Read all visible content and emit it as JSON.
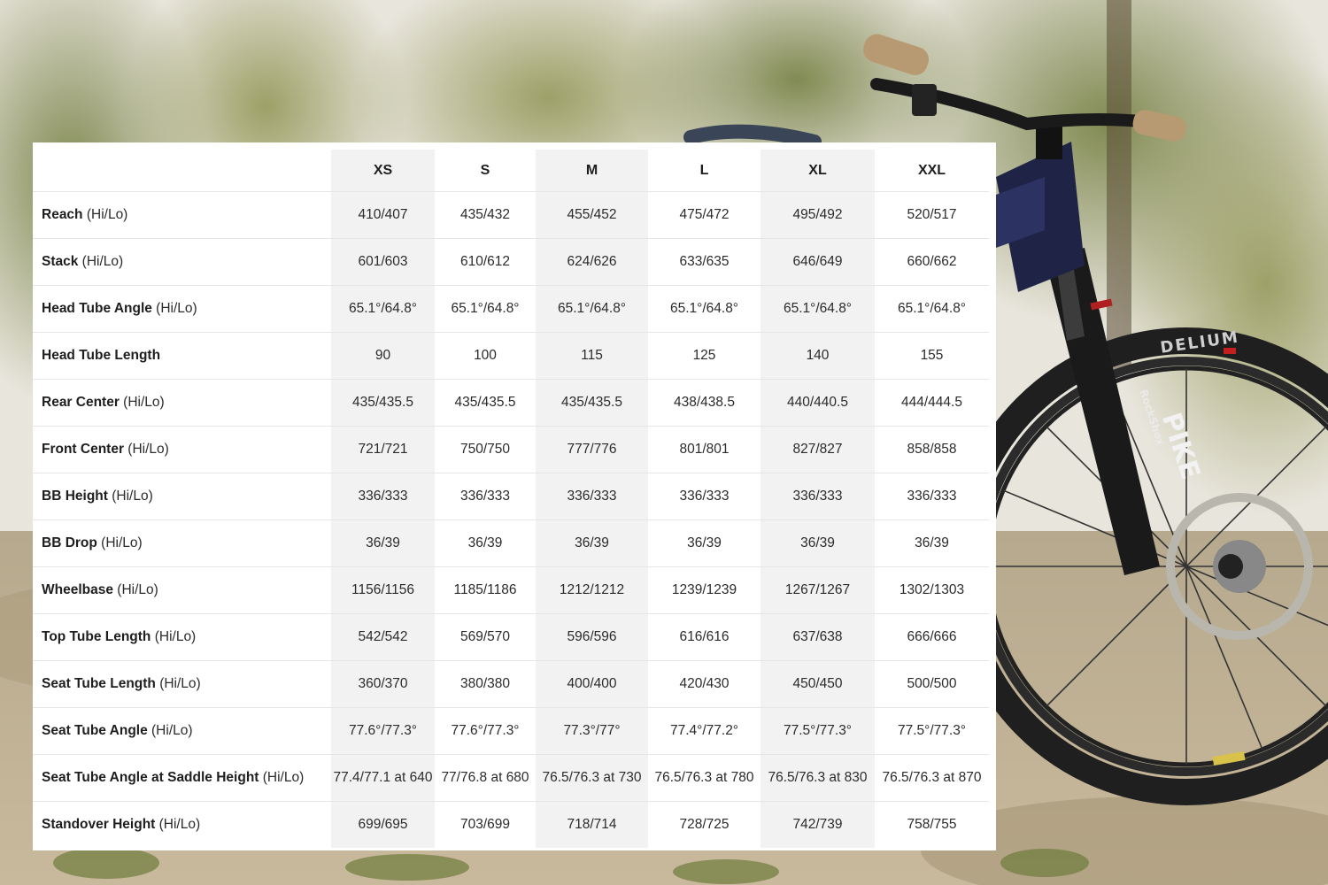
{
  "sizes": [
    "XS",
    "S",
    "M",
    "L",
    "XL",
    "XXL"
  ],
  "rows": [
    {
      "name": "Reach",
      "suffix": " (Hi/Lo)",
      "values": [
        "410/407",
        "435/432",
        "455/452",
        "475/472",
        "495/492",
        "520/517"
      ]
    },
    {
      "name": "Stack",
      "suffix": " (Hi/Lo)",
      "values": [
        "601/603",
        "610/612",
        "624/626",
        "633/635",
        "646/649",
        "660/662"
      ]
    },
    {
      "name": "Head Tube Angle",
      "suffix": " (Hi/Lo)",
      "values": [
        "65.1°/64.8°",
        "65.1°/64.8°",
        "65.1°/64.8°",
        "65.1°/64.8°",
        "65.1°/64.8°",
        "65.1°/64.8°"
      ]
    },
    {
      "name": "Head Tube Length",
      "suffix": "",
      "values": [
        "90",
        "100",
        "115",
        "125",
        "140",
        "155"
      ]
    },
    {
      "name": "Rear Center",
      "suffix": " (Hi/Lo)",
      "values": [
        "435/435.5",
        "435/435.5",
        "435/435.5",
        "438/438.5",
        "440/440.5",
        "444/444.5"
      ]
    },
    {
      "name": "Front Center",
      "suffix": " (Hi/Lo)",
      "values": [
        "721/721",
        "750/750",
        "777/776",
        "801/801",
        "827/827",
        "858/858"
      ]
    },
    {
      "name": "BB Height",
      "suffix": " (Hi/Lo)",
      "values": [
        "336/333",
        "336/333",
        "336/333",
        "336/333",
        "336/333",
        "336/333"
      ]
    },
    {
      "name": "BB Drop",
      "suffix": " (Hi/Lo)",
      "values": [
        "36/39",
        "36/39",
        "36/39",
        "36/39",
        "36/39",
        "36/39"
      ]
    },
    {
      "name": "Wheelbase",
      "suffix": " (Hi/Lo)",
      "values": [
        "1156/1156",
        "1185/1186",
        "1212/1212",
        "1239/1239",
        "1267/1267",
        "1302/1303"
      ]
    },
    {
      "name": "Top Tube Length",
      "suffix": " (Hi/Lo)",
      "values": [
        "542/542",
        "569/570",
        "596/596",
        "616/616",
        "637/638",
        "666/666"
      ]
    },
    {
      "name": "Seat Tube Length",
      "suffix": " (Hi/Lo)",
      "values": [
        "360/370",
        "380/380",
        "400/400",
        "420/430",
        "450/450",
        "500/500"
      ]
    },
    {
      "name": "Seat Tube Angle",
      "suffix": " (Hi/Lo)",
      "values": [
        "77.6°/77.3°",
        "77.6°/77.3°",
        "77.3°/77°",
        "77.4°/77.2°",
        "77.5°/77.3°",
        "77.5°/77.3°"
      ]
    },
    {
      "name": "Seat Tube Angle at Saddle Height",
      "suffix": " (Hi/Lo)",
      "values": [
        "77.4/77.1 at 640",
        "77/76.8 at 680",
        "76.5/76.3 at 730",
        "76.5/76.3 at 780",
        "76.5/76.3 at 830",
        "76.5/76.3 at 870"
      ]
    },
    {
      "name": "Standover Height",
      "suffix": " (Hi/Lo)",
      "values": [
        "699/695",
        "703/699",
        "718/714",
        "728/725",
        "742/739",
        "758/755"
      ]
    }
  ],
  "photo": {
    "tire_brand": "DELIUM",
    "fork_brand": "RockShox",
    "fork_model": "PIKE"
  },
  "colors": {
    "table_bg": "#ffffff",
    "shaded_column": "#f2f2f2",
    "row_divider": "#e6e6e6",
    "text": "#2b2b2b"
  }
}
